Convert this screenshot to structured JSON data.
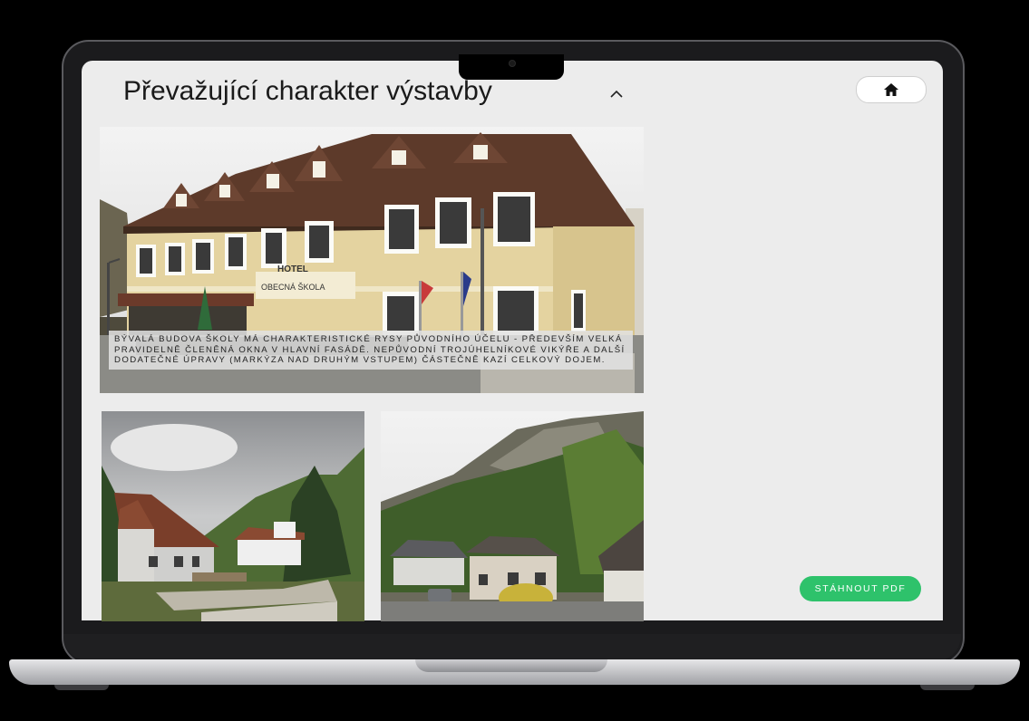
{
  "header": {
    "title": "Převažující charakter výstavby"
  },
  "icons": {
    "collapse": "chevron-up-icon",
    "home": "home-icon"
  },
  "main_photo": {
    "sign_hotel": "HOTEL",
    "sign_school": "OBECNÁ ŠKOLA",
    "caption": "Bývalá budova školy má charakteristické rysy původního účelu - především velká pravidelně členěná okna v hlavní fasádě. Nepůvodní trojúhelníkové vikýře a další dodatečné úpravy (markýza nad druhým vstupem) částečně kazí celkový dojem."
  },
  "actions": {
    "download_label": "STÁHNOUT PDF"
  },
  "colors": {
    "accent": "#2ec26b",
    "screen_bg": "#ececec",
    "facade": "#e4d3a0"
  }
}
